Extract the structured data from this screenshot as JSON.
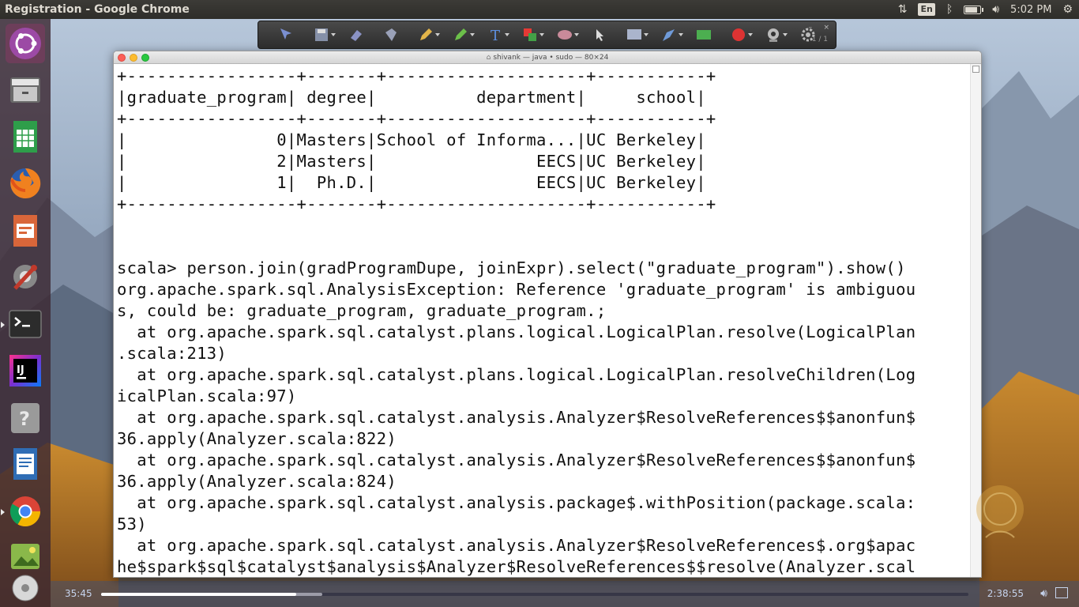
{
  "top_panel": {
    "window_title": "Registration - Google Chrome",
    "keyboard_layout": "En",
    "clock": "5:02 PM",
    "battery_level": 0.85,
    "icons": [
      "sort-arrows-icon",
      "keyboard-icon",
      "bluetooth-icon",
      "battery-icon",
      "volume-icon",
      "settings-gear-icon"
    ]
  },
  "launcher": {
    "items": [
      {
        "name": "ubuntu-dash-icon"
      },
      {
        "name": "file-manager-icon"
      },
      {
        "name": "spreadsheet-app-icon"
      },
      {
        "name": "firefox-icon"
      },
      {
        "name": "presentation-app-icon"
      },
      {
        "name": "system-settings-icon"
      },
      {
        "name": "terminal-icon"
      },
      {
        "name": "intellij-idea-icon"
      },
      {
        "name": "help-icon"
      },
      {
        "name": "text-editor-icon"
      },
      {
        "name": "chrome-icon"
      },
      {
        "name": "image-viewer-icon"
      },
      {
        "name": "disk-icon"
      }
    ]
  },
  "annotation_toolbar": {
    "page_indicator": "1 / 1",
    "tools": [
      "pointer-tool-icon",
      "save-tool-icon",
      "eraser-tool-icon",
      "shape-tool-icon",
      "pencil-tool-icon",
      "highlighter-tool-icon",
      "text-tool-icon",
      "color-tool-icon",
      "rubber-tool-icon",
      "arrow-cursor-icon",
      "screen-tool-icon",
      "pen-tool-icon",
      "green-rect-icon",
      "red-record-icon",
      "webcam-icon",
      "gear-tool-icon"
    ]
  },
  "terminal": {
    "title": "shivank — java • sudo — 80×24",
    "lines": [
      "+-----------------+-------+--------------------+-----------+",
      "|graduate_program| degree|          department|     school|",
      "+-----------------+-------+--------------------+-----------+",
      "|               0|Masters|School of Informa...|UC Berkeley|",
      "|               2|Masters|                EECS|UC Berkeley|",
      "|               1|  Ph.D.|                EECS|UC Berkeley|",
      "+-----------------+-------+--------------------+-----------+",
      "",
      "",
      "scala> person.join(gradProgramDupe, joinExpr).select(\"graduate_program\").show()",
      "org.apache.spark.sql.AnalysisException: Reference 'graduate_program' is ambiguou",
      "s, could be: graduate_program, graduate_program.;",
      "  at org.apache.spark.sql.catalyst.plans.logical.LogicalPlan.resolve(LogicalPlan",
      ".scala:213)",
      "  at org.apache.spark.sql.catalyst.plans.logical.LogicalPlan.resolveChildren(Log",
      "icalPlan.scala:97)",
      "  at org.apache.spark.sql.catalyst.analysis.Analyzer$ResolveReferences$$anonfun$",
      "36.apply(Analyzer.scala:822)",
      "  at org.apache.spark.sql.catalyst.analysis.Analyzer$ResolveReferences$$anonfun$",
      "36.apply(Analyzer.scala:824)",
      "  at org.apache.spark.sql.catalyst.analysis.package$.withPosition(package.scala:",
      "53)",
      "  at org.apache.spark.sql.catalyst.analysis.Analyzer$ResolveReferences$.org$apac",
      "he$spark$sql$catalyst$analysis$Analyzer$ResolveReferences$$resolve(Analyzer.scal"
    ]
  },
  "player": {
    "elapsed": "35:45",
    "duration": "2:38:55",
    "progress": 0.225,
    "buffered": 0.255
  },
  "colors": {
    "panel": "#3c3b37",
    "launcher": "#3c2832",
    "terminal_bg": "#ffffff",
    "terminal_text": "#111111"
  }
}
